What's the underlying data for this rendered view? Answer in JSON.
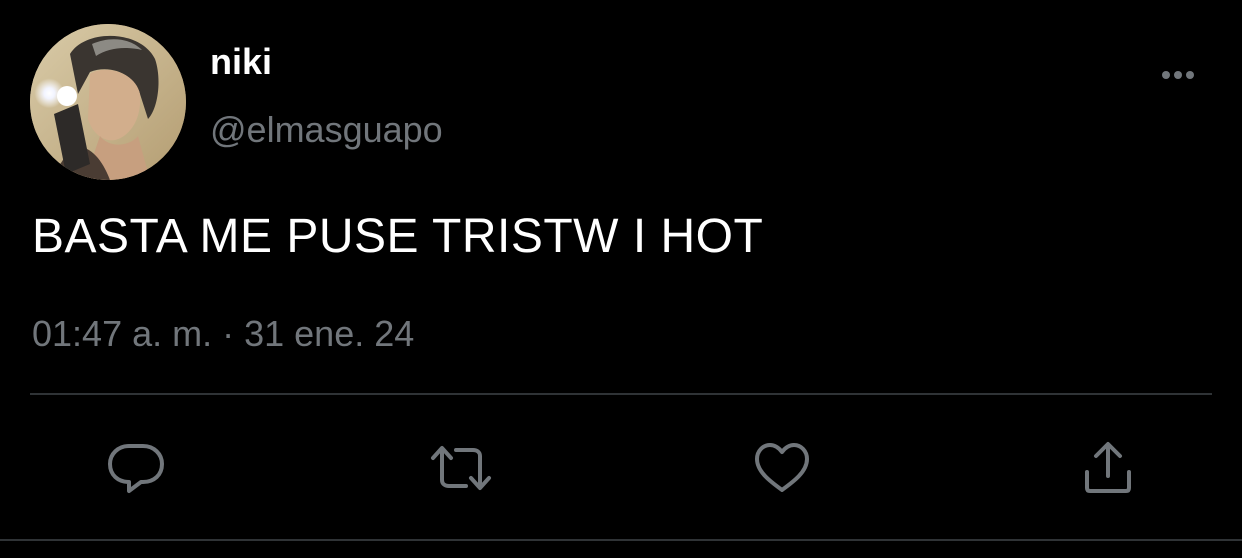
{
  "user": {
    "display_name": "niki",
    "handle": "@elmasguapo"
  },
  "tweet": {
    "text": "BASTA ME PUSE TRISTW I HOT",
    "time": "01:47 a. m.",
    "separator": " · ",
    "date": "31 ene. 24"
  },
  "actions": {
    "reply_icon": "speech-bubble-icon",
    "retweet_icon": "retweet-icon",
    "like_icon": "heart-icon",
    "share_icon": "share-upload-icon",
    "more_icon": "ellipsis-icon"
  },
  "colors": {
    "background": "#000000",
    "primary_text": "#ffffff",
    "secondary_text": "#71767b",
    "divider": "#2f3336"
  }
}
